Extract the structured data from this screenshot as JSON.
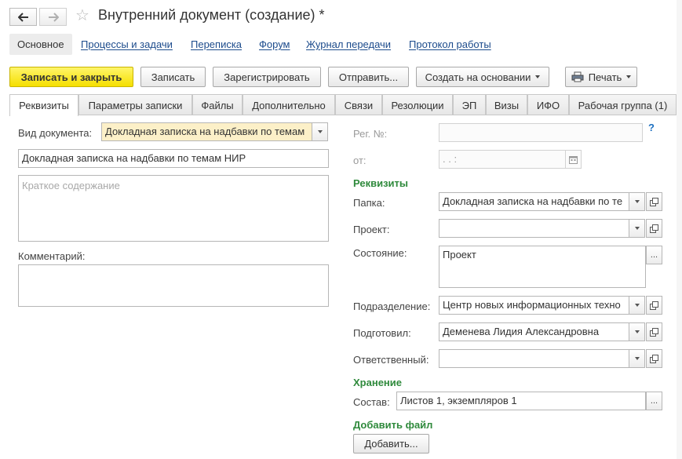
{
  "nav": {
    "back_icon": "arrow-left-icon",
    "forward_icon": "arrow-right-icon",
    "favorite_icon": "star-icon"
  },
  "window": {
    "title": "Внутренний документ (создание) *"
  },
  "section_tabs": [
    {
      "label": "Основное",
      "active": true
    },
    {
      "label": "Процессы и задачи"
    },
    {
      "label": "Переписка"
    },
    {
      "label": "Форум"
    },
    {
      "label": "Журнал передачи"
    },
    {
      "label": "Протокол работы"
    }
  ],
  "toolbar": {
    "write_close": "Записать и закрыть",
    "write": "Записать",
    "register": "Зарегистрировать",
    "send": "Отправить...",
    "create_based": "Создать на основании",
    "print": "Печать",
    "print_icon": "printer-icon"
  },
  "form_tabs": [
    {
      "label": "Реквизиты",
      "active": true
    },
    {
      "label": "Параметры записки"
    },
    {
      "label": "Файлы"
    },
    {
      "label": "Дополнительно"
    },
    {
      "label": "Связи"
    },
    {
      "label": "Резолюции"
    },
    {
      "label": "ЭП"
    },
    {
      "label": "Визы"
    },
    {
      "label": "ИФО"
    },
    {
      "label": "Рабочая группа (1)"
    }
  ],
  "left": {
    "doc_type_label": "Вид документа:",
    "doc_type_value": "Докладная записка на надбавки по темам",
    "title_value": "Докладная записка на надбавки по темам НИР",
    "summary_placeholder": "Краткое содержание",
    "comment_label": "Комментарий:",
    "comment_value": ""
  },
  "right": {
    "reg_no_label": "Рег. №:",
    "reg_no_value": "",
    "help": "?",
    "from_label": "от:",
    "from_value": " .  .     :  ",
    "calendar_icon": "calendar-icon",
    "requisites_group": "Реквизиты",
    "folder_label": "Папка:",
    "folder_value": "Докладная записка на надбавки по те",
    "project_label": "Проект:",
    "project_value": "",
    "state_label": "Состояние:",
    "state_value": "Проект",
    "department_label": "Подразделение:",
    "department_value": "Центр новых информационных техно",
    "prepared_label": "Подготовил:",
    "prepared_value": "Деменева Лидия Александровна",
    "responsible_label": "Ответственный:",
    "responsible_value": "",
    "storage_group": "Хранение",
    "composition_label": "Состав:",
    "composition_value": "Листов 1, экземпляров 1",
    "add_file_group": "Добавить файл",
    "add_button": "Добавить...",
    "open_icon": "open-form-icon",
    "ellipsis": "...",
    "dropdown_icon": "chevron-down-icon"
  }
}
